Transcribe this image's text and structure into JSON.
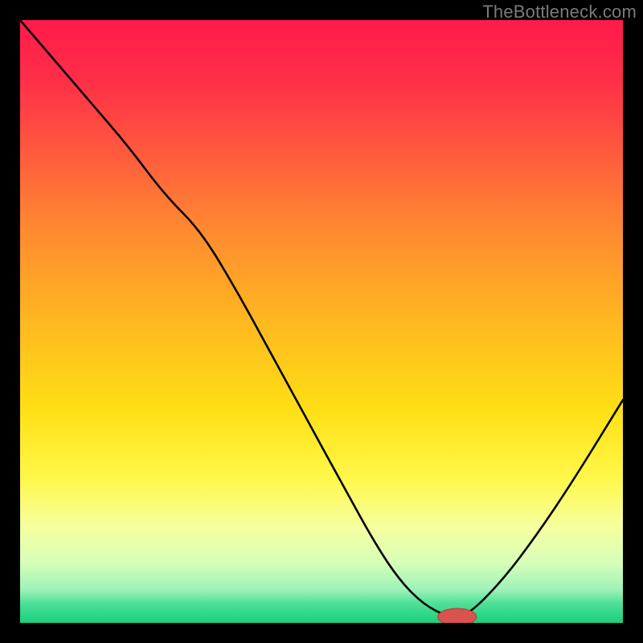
{
  "watermark": "TheBottleneck.com",
  "colors": {
    "frame": "#000000",
    "curve": "#000000",
    "marker_fill": "#d9534f",
    "marker_stroke": "#c9302c",
    "gradient_stops": [
      {
        "offset": 0.0,
        "color": "#ff1a4b"
      },
      {
        "offset": 0.1,
        "color": "#ff2f48"
      },
      {
        "offset": 0.22,
        "color": "#ff5a3e"
      },
      {
        "offset": 0.35,
        "color": "#ff8a30"
      },
      {
        "offset": 0.5,
        "color": "#ffb820"
      },
      {
        "offset": 0.65,
        "color": "#ffe015"
      },
      {
        "offset": 0.76,
        "color": "#fff84a"
      },
      {
        "offset": 0.84,
        "color": "#f6ff9e"
      },
      {
        "offset": 0.9,
        "color": "#d7ffb9"
      },
      {
        "offset": 0.945,
        "color": "#9ef2b8"
      },
      {
        "offset": 0.968,
        "color": "#4de099"
      },
      {
        "offset": 1.0,
        "color": "#18cf7a"
      }
    ]
  },
  "chart_data": {
    "type": "line",
    "title": "",
    "xlabel": "",
    "ylabel": "",
    "xlim": [
      0,
      100
    ],
    "ylim": [
      0,
      100
    ],
    "x": [
      0,
      6,
      12,
      18,
      24,
      30,
      36,
      42,
      48,
      54,
      59,
      63,
      67,
      71,
      74,
      80,
      86,
      92,
      100
    ],
    "values": [
      100,
      93,
      86,
      79,
      71,
      65,
      55,
      44,
      33,
      22,
      13,
      7,
      3,
      1,
      1,
      7,
      15,
      24,
      37
    ],
    "marker": {
      "x": 72.5,
      "y": 1.0,
      "rx": 3.2,
      "ry": 1.4
    }
  }
}
